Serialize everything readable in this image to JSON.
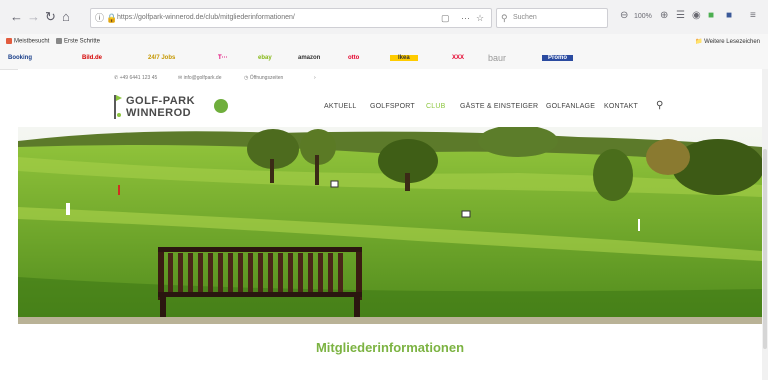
{
  "browser": {
    "url": "https://golfpark-winnerod.de/club/mitgliederinformationen/",
    "search_placeholder": "Suchen",
    "zoom": "100%"
  },
  "bookmarks": {
    "items": [
      {
        "label": "Meistbesucht",
        "color": "#e25c3e"
      },
      {
        "label": "Erste Schritte",
        "color": "#888888"
      }
    ],
    "other_label": "Weitere Lesezeichen"
  },
  "brandbar": {
    "items": [
      {
        "label": "Booking",
        "color": "#1a3f8a"
      },
      {
        "label": "Bild.de",
        "color": "#d40000"
      },
      {
        "label": "24/7 Jobs",
        "color": "#c59700"
      },
      {
        "label": "T···",
        "color": "#e20074"
      },
      {
        "label": "ebay",
        "color": "#86b817"
      },
      {
        "label": "amazon",
        "color": "#333333"
      },
      {
        "label": "otto",
        "color": "#e4002b"
      },
      {
        "label": "Ikea",
        "color": "#ffcc00"
      },
      {
        "label": "XXX",
        "color": "#e4002b"
      },
      {
        "label": "baur",
        "color": "#9a9a9a"
      },
      {
        "label": "Promo",
        "color": "#2b4ba0"
      }
    ]
  },
  "topinfo": {
    "items": [
      "+49 6441 123 45",
      "info@golfpark.de",
      "Öffnungszeiten"
    ]
  },
  "site": {
    "logo_line1": "GOLF-PARK",
    "logo_line2": "WINNEROD",
    "nav": [
      {
        "label": "AKTUELL",
        "active": false
      },
      {
        "label": "GOLFSPORT",
        "active": false
      },
      {
        "label": "CLUB",
        "active": true
      },
      {
        "label": "GÄSTE & EINSTEIGER",
        "active": false
      },
      {
        "label": "GOLFANLAGE",
        "active": false
      },
      {
        "label": "KONTAKT",
        "active": false
      }
    ]
  },
  "page": {
    "heading": "Mitgliederinformationen"
  },
  "colors": {
    "accent_green": "#7cb342",
    "nav_active": "#8cc63f"
  }
}
